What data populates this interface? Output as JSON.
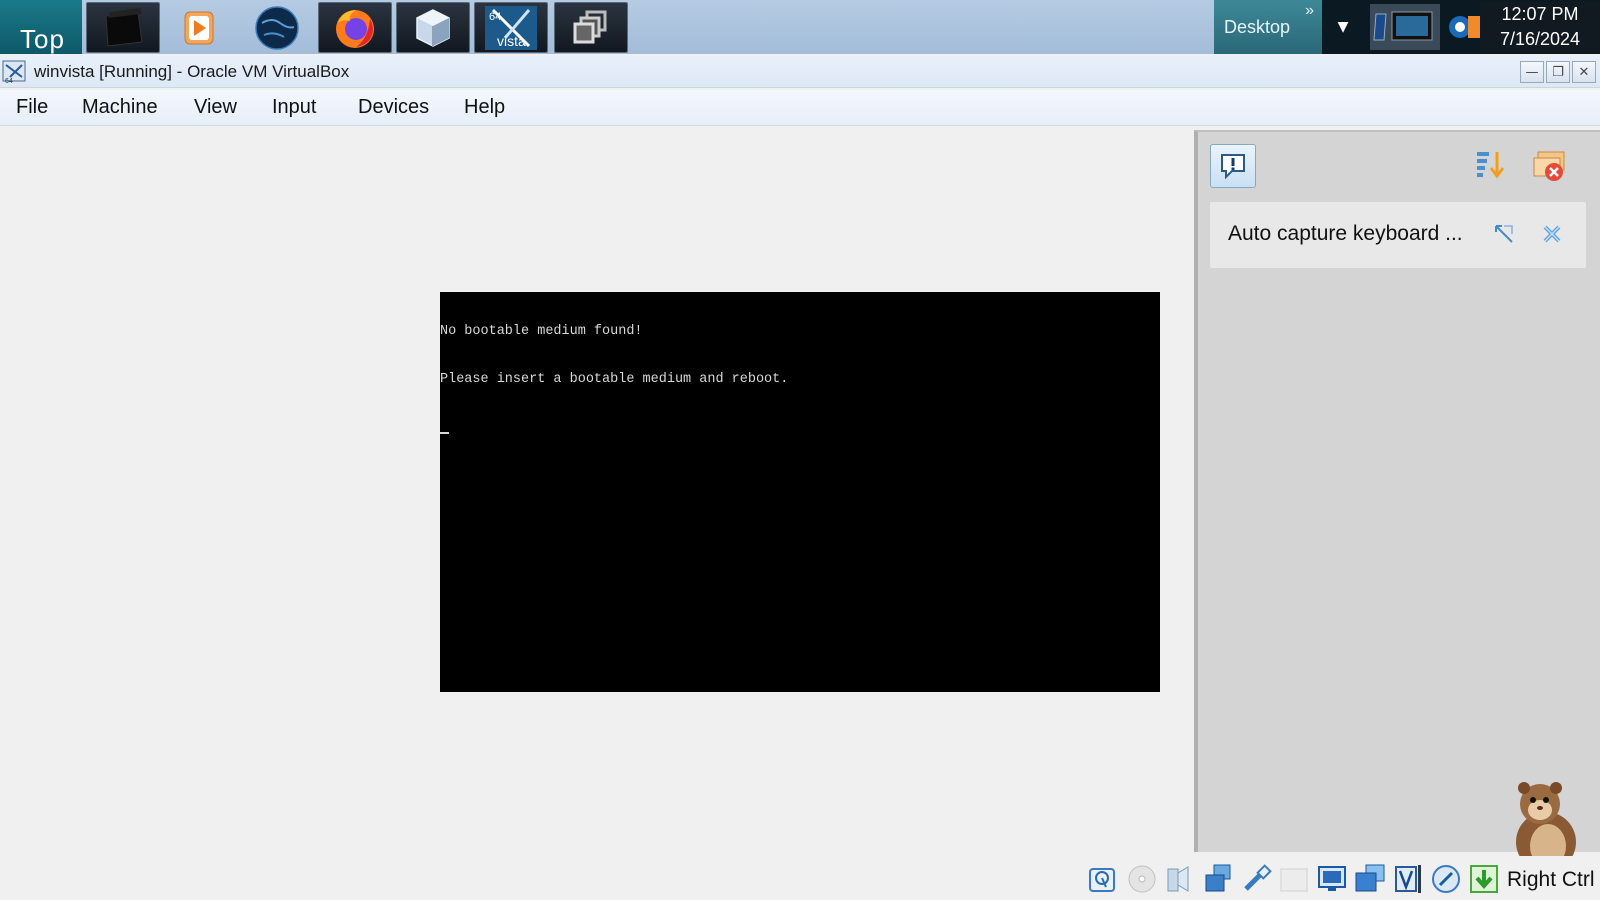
{
  "taskbar": {
    "start_label": "Top",
    "apps": [
      {
        "icon": "dark-window-icon"
      },
      {
        "icon": "media-player-icon"
      },
      {
        "icon": "globe-icon"
      },
      {
        "icon": "firefox-icon"
      },
      {
        "icon": "virtualbox-icon"
      },
      {
        "icon": "vista-64-icon",
        "badge": "64",
        "caption": "vista"
      },
      {
        "icon": "stacked-windows-icon"
      }
    ],
    "desktop_label": "Desktop",
    "desktop_chevron": "»",
    "clock": {
      "time": "12:07 PM",
      "date": "7/16/2024"
    }
  },
  "window": {
    "title": "winvista [Running] - Oracle VM VirtualBox",
    "controls": {
      "minimize": "—",
      "restore": "❐",
      "close": "✕"
    }
  },
  "menu": {
    "items": [
      "File",
      "Machine",
      "View",
      "Input",
      "Devices",
      "Help"
    ]
  },
  "vm_screen": {
    "lines": [
      "No bootable medium found!",
      "Please insert a bootable medium and reboot."
    ],
    "background": "#000000",
    "text_color": "#d8d8d8"
  },
  "notification_center": {
    "message": "Auto capture keyboard ..."
  },
  "statusbar": {
    "icons": [
      "hard-disk-icon",
      "optical-drive-icon",
      "audio-icon",
      "network-icon",
      "usb-icon",
      "shared-folders-icon",
      "display-icon",
      "recording-icon",
      "cpu-virtualization-icon",
      "mouse-integration-icon",
      "keyboard-capture-icon"
    ],
    "host_key": "Right Ctrl"
  }
}
